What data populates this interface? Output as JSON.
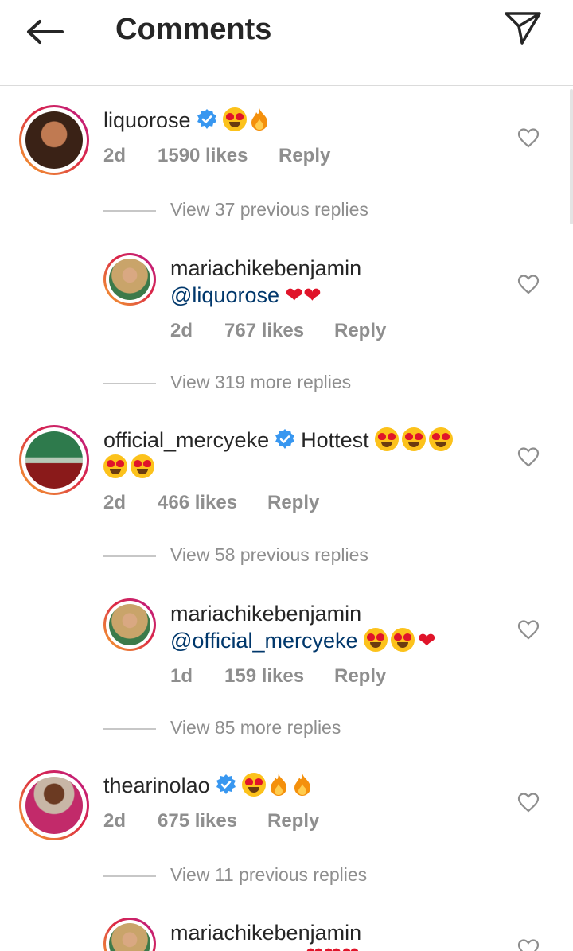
{
  "header": {
    "title": "Comments"
  },
  "comments": [
    {
      "username": "liquorose",
      "verified": true,
      "emoji": "😍🔥",
      "time": "2d",
      "likes": "1590 likes",
      "reply": "Reply",
      "view_replies": "View 37 previous replies",
      "reply_item": {
        "username": "mariachikebenjamin",
        "mention": "@liquorose",
        "emoji": "❤️❤️",
        "time": "2d",
        "likes": "767 likes",
        "reply": "Reply",
        "view_replies": "View 319 more replies"
      }
    },
    {
      "username": "official_mercyeke",
      "verified": true,
      "text": "Hottest",
      "emoji": "😍😍😍😍😍",
      "time": "2d",
      "likes": "466 likes",
      "reply": "Reply",
      "view_replies": "View 58 previous replies",
      "reply_item": {
        "username": "mariachikebenjamin",
        "mention": "@official_mercyeke",
        "emoji": "😍😍❤️",
        "time": "1d",
        "likes": "159 likes",
        "reply": "Reply",
        "view_replies": "View 85 more replies"
      }
    },
    {
      "username": "thearinolao",
      "verified": true,
      "emoji": "😍🔥🔥",
      "time": "2d",
      "likes": "675 likes",
      "reply": "Reply",
      "view_replies": "View 11 previous replies",
      "reply_item": {
        "username": "mariachikebenjamin"
      }
    }
  ],
  "colors": {
    "verified": "#3897f0",
    "secondary_text": "#8e8e8e",
    "mention": "#00376b"
  }
}
